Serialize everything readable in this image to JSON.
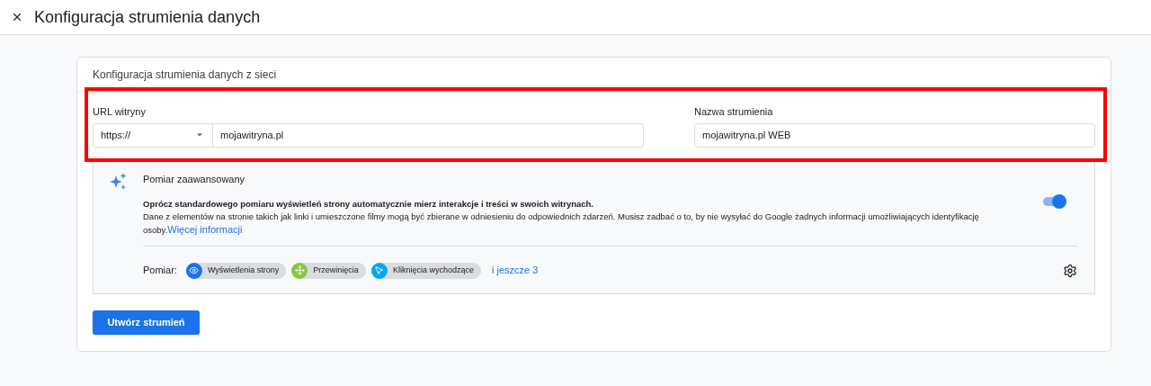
{
  "header": {
    "title": "Konfiguracja strumienia danych"
  },
  "card": {
    "title": "Konfiguracja strumienia danych z sieci",
    "url_field": {
      "label": "URL witryny",
      "protocol": "https://",
      "value": "mojawitryna.pl"
    },
    "name_field": {
      "label": "Nazwa strumienia",
      "value": "mojawitryna.pl WEB"
    },
    "advanced": {
      "title": "Pomiar zaawansowany",
      "description": "**Oprócz standardowego pomiaru wyświetleń strony automatycznie mierz interakcje i treści w swoich witrynach.**",
      "details": "Dane z elementów na stronie takich jak linki i umieszczone filmy mogą być zbierane w odniesieniu do odpowiednich zdarzeń. Musisz zadbać o to, by nie wysyłać do Google żadnych informacji umożliwiających identyfikację osoby.",
      "link": "Więcej informacji",
      "on": true,
      "measure_label": "Pomiar:",
      "chips": [
        {
          "label": "Wyświetlenia strony",
          "color": "#1a73e8"
        },
        {
          "label": "Przewinięcia",
          "color": "#8bc34a"
        },
        {
          "label": "Kliknięcia wychodzące",
          "color": "#03a9f4"
        }
      ],
      "more": "i jeszcze 3"
    },
    "button": "Utwórz strumień"
  }
}
